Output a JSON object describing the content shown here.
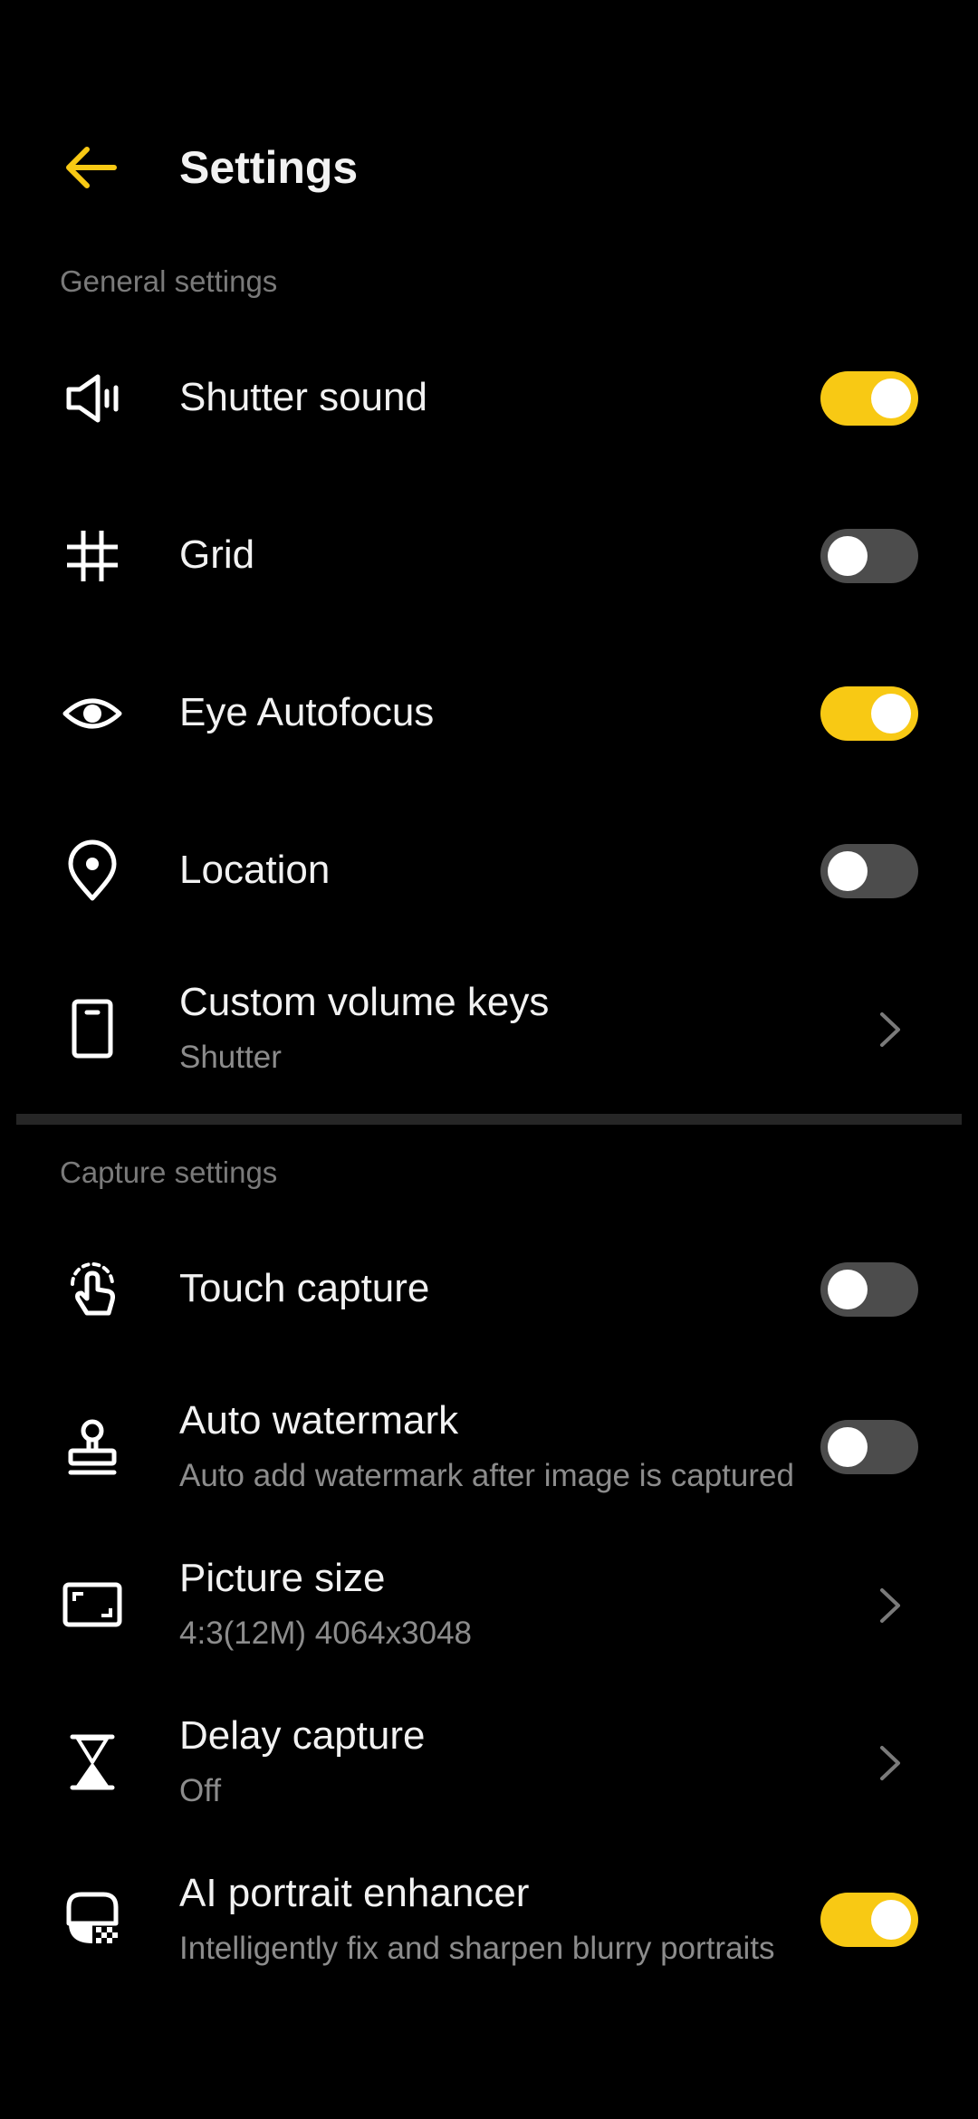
{
  "header": {
    "title": "Settings",
    "back_icon": "arrow-left-icon"
  },
  "accent": "#f8c914",
  "general": {
    "section_label": "General settings",
    "shutter_sound": {
      "label": "Shutter sound",
      "on": true,
      "icon": "speaker-icon"
    },
    "grid": {
      "label": "Grid",
      "on": false,
      "icon": "grid-icon"
    },
    "eye_autofocus": {
      "label": "Eye Autofocus",
      "on": true,
      "icon": "eye-icon"
    },
    "location": {
      "label": "Location",
      "on": false,
      "icon": "location-pin-icon"
    },
    "volume_keys": {
      "label": "Custom volume keys",
      "value": "Shutter",
      "icon": "phone-icon"
    }
  },
  "capture": {
    "section_label": "Capture settings",
    "touch_capture": {
      "label": "Touch capture",
      "on": false,
      "icon": "touch-hand-icon"
    },
    "auto_watermark": {
      "label": "Auto watermark",
      "desc": "Auto add watermark after image is captured",
      "on": false,
      "icon": "stamp-icon"
    },
    "picture_size": {
      "label": "Picture size",
      "value": "4:3(12M) 4064x3048",
      "icon": "aspect-ratio-icon"
    },
    "delay_capture": {
      "label": "Delay capture",
      "value": "Off",
      "icon": "hourglass-icon"
    },
    "ai_portrait": {
      "label": "AI portrait enhancer",
      "desc": "Intelligently fix and sharpen blurry portraits",
      "on": true,
      "icon": "ai-portrait-icon"
    }
  }
}
